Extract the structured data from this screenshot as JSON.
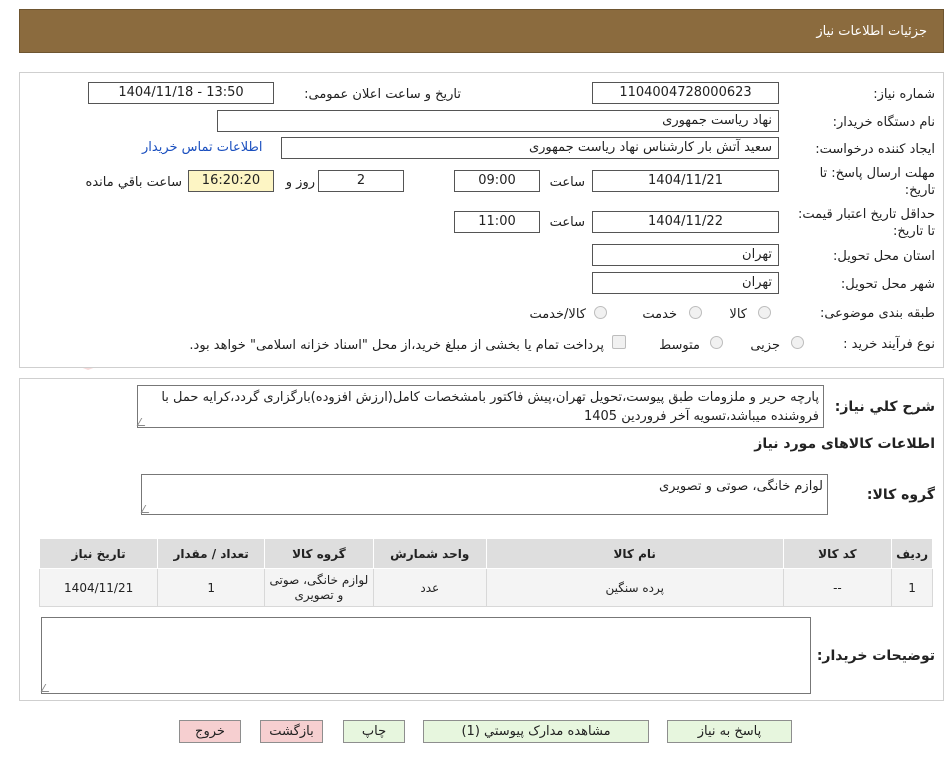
{
  "header": {
    "title": "جزئيات اطلاعات نياز"
  },
  "fields": {
    "need_number_label": "شماره نیاز:",
    "need_number": "1104004728000623",
    "announce_label": "تاريخ و ساعت اعلان عمومی:",
    "announce_value": "1404/11/18 - 13:50",
    "buyer_org_label": "نام دستگاه خريدار:",
    "buyer_org": "نهاد ریاست جمهوری",
    "creator_label": "ايجاد کننده درخواست:",
    "creator": "سعید آتش بار کارشناس نهاد ریاست جمهوری",
    "contact_link": "اطلاعات تماس خریدار",
    "deadline_label": "مهلت ارسال پاسخ: تا تاریخ:",
    "deadline_date": "1404/11/21",
    "time_label": "ساعت",
    "deadline_time": "09:00",
    "days_value": "2",
    "days_label": "روز و",
    "remaining_time": "16:20:20",
    "remaining_label": "ساعت باقي مانده",
    "validity_label": "حداقل تاريخ اعتبار قيمت: تا تاريخ:",
    "validity_date": "1404/11/22",
    "validity_time_label": "ساعت",
    "validity_time": "11:00",
    "province_label": "استان محل تحویل:",
    "province": "تهران",
    "city_label": "شهر محل تحویل:",
    "city": "تهران",
    "category_label": "طبقه بندی موضوعی:",
    "category_options": [
      "کالا",
      "خدمت",
      "کالا/خدمت"
    ],
    "process_label": "نوع فرآيند خريد :",
    "process_options": [
      "جزیی",
      "متوسط"
    ],
    "payment_note": "پرداخت تمام یا بخشی از مبلغ خرید،از محل \"اسناد خزانه اسلامی\" خواهد بود."
  },
  "description": {
    "label": "شرح كلي نياز:",
    "text": "پارچه حریر و ملزومات طبق پیوست،تحویل تهران،پیش فاکتور بامشخصات کامل(ارزش افزوده)بارگزاری گردد،کرایه حمل با فروشنده میباشد،تسویه آخر فروردین 1405"
  },
  "goods": {
    "section_title": "اطلاعات کالاهای مورد نیاز",
    "group_label": "گروه کالا:",
    "group_value": "لوازم خانگی، صوتی و تصویری"
  },
  "table": {
    "headers": [
      "ردیف",
      "کد کالا",
      "نام کالا",
      "واحد شمارش",
      "گروه کالا",
      "تعداد / مقدار",
      "تاریخ نیاز"
    ],
    "rows": [
      [
        "1",
        "--",
        "پرده سنگین",
        "عدد",
        "لوازم خانگی، صوتی و تصویری",
        "1",
        "1404/11/21"
      ]
    ]
  },
  "buyer_notes": {
    "label": "توضیحات خریدار:"
  },
  "buttons": {
    "reply": "پاسخ به نياز",
    "attachments": "مشاهده مدارک پيوستي (1)",
    "print": "چاپ",
    "back": "بازگشت",
    "exit": "خروج"
  },
  "colors": {
    "header_bg": "#8b6b3e",
    "green_btn": "#e7f6de",
    "pink_btn": "#f6cfd0",
    "yellow_box": "#fdf5c4"
  }
}
